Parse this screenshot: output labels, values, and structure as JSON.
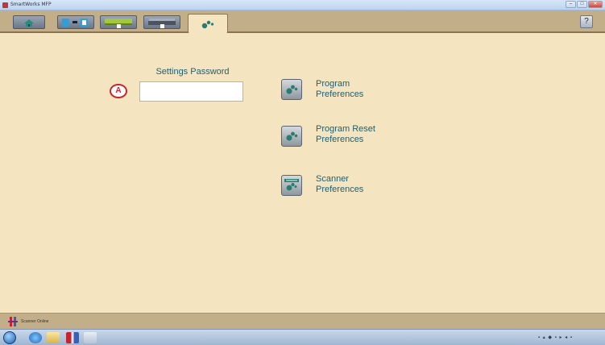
{
  "window": {
    "title": "SmartWorks MFP",
    "controls": {
      "minimize": "–",
      "maximize": "□",
      "close": "✕"
    }
  },
  "toolbar": {
    "tabs": [
      {
        "name": "home",
        "icon": "home-icon"
      },
      {
        "name": "copy",
        "icon": "copy-icon"
      },
      {
        "name": "scan",
        "icon": "scan-icon"
      },
      {
        "name": "print",
        "icon": "print-icon"
      },
      {
        "name": "settings",
        "icon": "settings-dots-icon",
        "active": true
      }
    ],
    "help_label": "?"
  },
  "settings": {
    "password_label": "Settings Password",
    "password_value": "",
    "marker": "A"
  },
  "preferences": [
    {
      "line1": "Program",
      "line2": "Preferences",
      "icon": "settings-dots-icon"
    },
    {
      "line1": "Program Reset",
      "line2": "Preferences",
      "icon": "settings-dots-icon"
    },
    {
      "line1": "Scanner",
      "line2": "Preferences",
      "icon": "scanner-settings-icon"
    }
  ],
  "statusbar": {
    "text": "Scanner Online"
  },
  "colors": {
    "background": "#f4e4bf",
    "accent_text": "#1f5f73",
    "toolbar": "#c2af89",
    "marker": "#c8232c"
  }
}
